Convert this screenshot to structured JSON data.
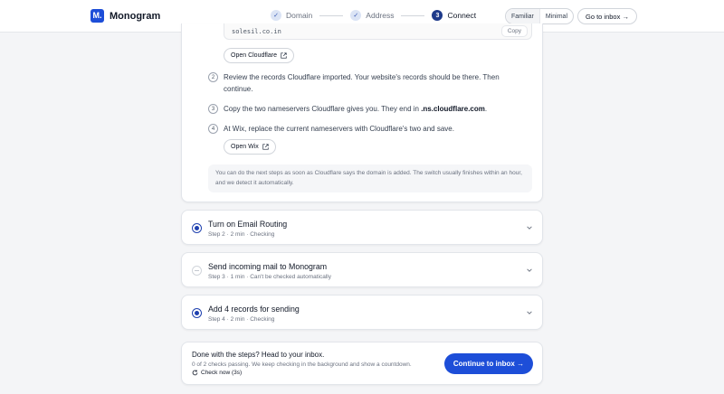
{
  "header": {
    "brand_mark": "M.",
    "brand_name": "Monogram",
    "steps": [
      {
        "label": "Domain",
        "state": "done"
      },
      {
        "label": "Address",
        "state": "done"
      },
      {
        "label": "Connect",
        "state": "current",
        "number": "3"
      }
    ],
    "view_modes": [
      "Familiar",
      "Minimal"
    ],
    "active_view_mode": "Familiar",
    "go_to_inbox": "Go to inbox →"
  },
  "connect": {
    "nameserver_value": "solesil.co.in",
    "copy_label": "Copy",
    "open_cloudflare": "Open Cloudflare",
    "instructions": [
      {
        "number": "2",
        "text": "Review the records Cloudflare imported. Your website's records should be there. Then continue."
      },
      {
        "number": "3",
        "text_before": "Copy the two nameservers Cloudflare gives you. They end in ",
        "text_bold": ".ns.cloudflare.com",
        "text_after": "."
      },
      {
        "number": "4",
        "text": "At Wix, replace the current nameservers with Cloudflare's two and save."
      }
    ],
    "open_wix": "Open Wix",
    "note": "You can do the next steps as soon as Cloudflare says the domain is added. The switch usually finishes within an hour, and we detect it automatically."
  },
  "tasks": [
    {
      "title": "Turn on Email Routing",
      "meta": "Step 2 · 2 min · Checking",
      "status": "checking"
    },
    {
      "title": "Send incoming mail to Monogram",
      "meta": "Step 3 · 1 min · Can't be checked automatically",
      "status": "manual"
    },
    {
      "title": "Add 4 records for sending",
      "meta": "Step 4 · 2 min · Checking",
      "status": "checking"
    }
  ],
  "footer": {
    "title": "Done with the steps? Head to your inbox.",
    "subtitle": "0 of 2 checks passing. We keep checking in the background and show a countdown.",
    "check_now": "Check now (3s)",
    "cta": "Continue to inbox →"
  },
  "colors": {
    "accent": "#1d4ed8",
    "accent_dark": "#1e3a8a",
    "background": "#f4f5f7"
  },
  "icons": [
    "check-icon",
    "external-link-icon",
    "chevron-down-icon",
    "refresh-icon",
    "arrow-right-icon"
  ]
}
